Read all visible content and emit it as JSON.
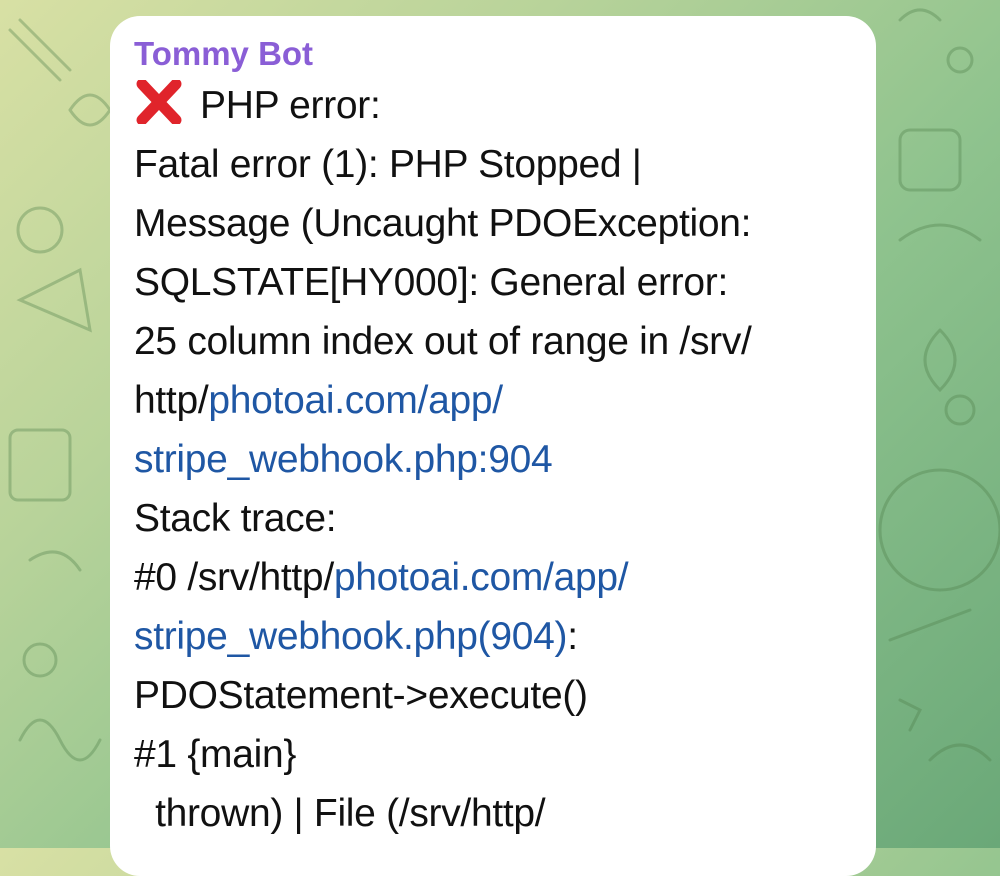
{
  "message": {
    "sender": "Tommy Bot",
    "title_text": "PHP error:",
    "error_icon": "cross-mark-icon",
    "lines": {
      "l1": "Fatal error (1): PHP Stopped |",
      "l2": "Message (Uncaught PDOException:",
      "l3": "SQLSTATE[HY000]: General error:",
      "l4": "25 column index out of range in /srv/",
      "l5_prefix": "http/",
      "l5_link": "photoai.com/app/",
      "l6_link": "stripe_webhook.php:904",
      "l7": "Stack trace:",
      "l8_prefix": "#0 /srv/http/",
      "l8_link": "photoai.com/app/",
      "l9_link": "stripe_webhook.php(904)",
      "l9_suffix": ":",
      "l10": "PDOStatement->execute()",
      "l11": "#1 {main}",
      "l12": "  thrown) | File (/srv/http/"
    }
  },
  "colors": {
    "sender": "#8a5ed6",
    "link": "#1f57a4",
    "error_icon": "#e0242b"
  }
}
